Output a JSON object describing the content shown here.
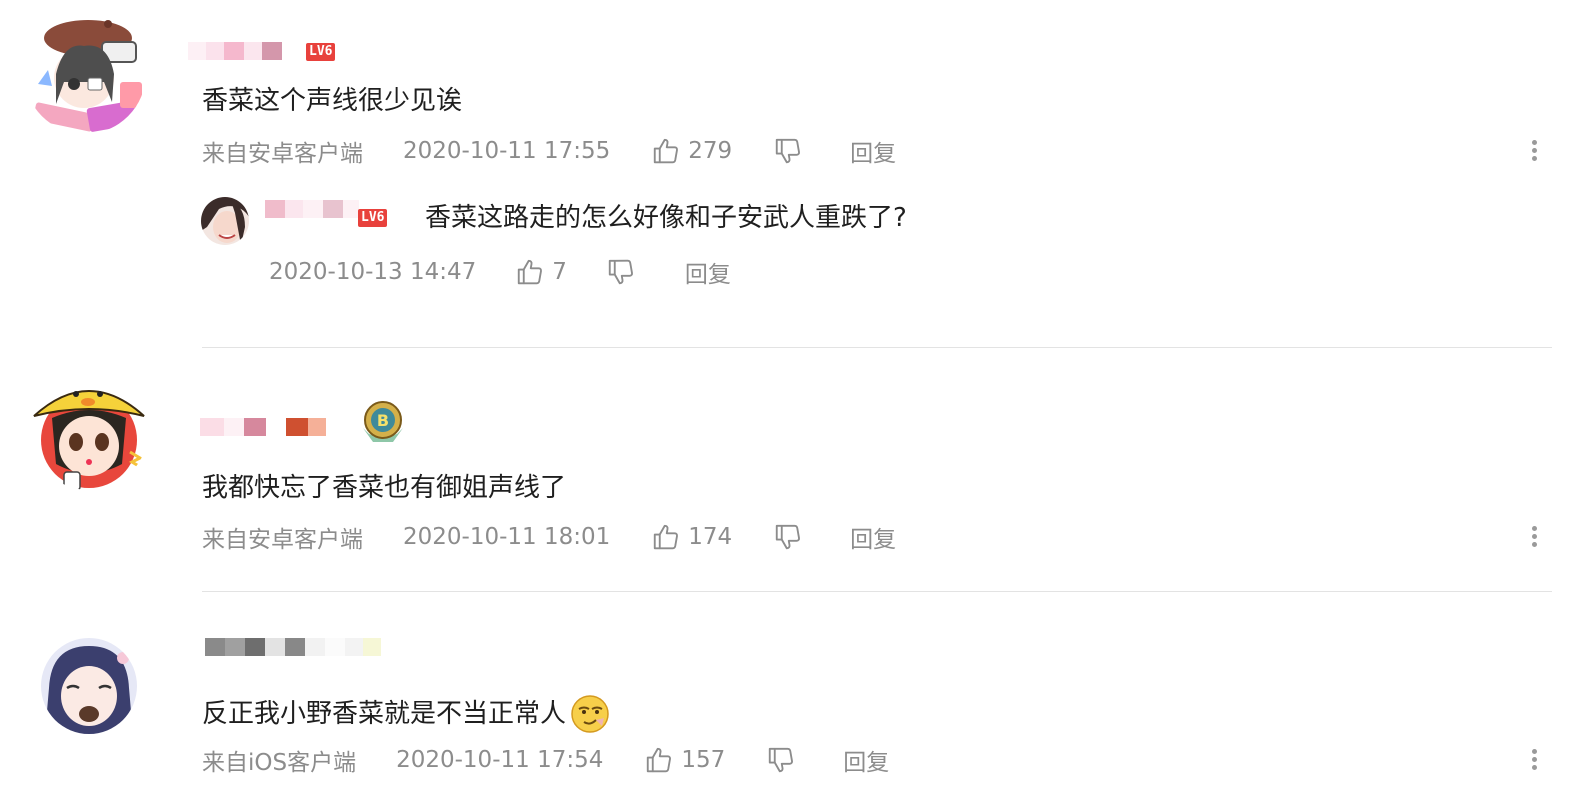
{
  "comments": [
    {
      "level": "LV6",
      "content": "香菜这个声线很少见诶",
      "source": "来自安卓客户端",
      "time": "2020-10-11 17:55",
      "likes": "279",
      "reply_label": "回复",
      "replies": [
        {
          "level": "LV6",
          "content": "香菜这路走的怎么好像和子安武人重跌了?",
          "time": "2020-10-13 14:47",
          "likes": "7",
          "reply_label": "回复"
        }
      ]
    },
    {
      "badge_letter": "B",
      "content": "我都快忘了香菜也有御姐声线了",
      "source": "来自安卓客户端",
      "time": "2020-10-11 18:01",
      "likes": "174",
      "reply_label": "回复"
    },
    {
      "content": "反正我小野香菜就是不当正常人",
      "source": "来自iOS客户端",
      "time": "2020-10-11 17:54",
      "likes": "157",
      "reply_label": "回复"
    }
  ],
  "colors": {
    "text": "#1f1f1f",
    "meta": "#8c8c8c",
    "level_badge": "#e8413c",
    "divider": "#e3e3e3"
  },
  "icons": [
    "thumb-up-icon",
    "thumb-down-icon",
    "more-vertical-icon",
    "emoji-smirk-icon",
    "medal-badge-icon"
  ]
}
